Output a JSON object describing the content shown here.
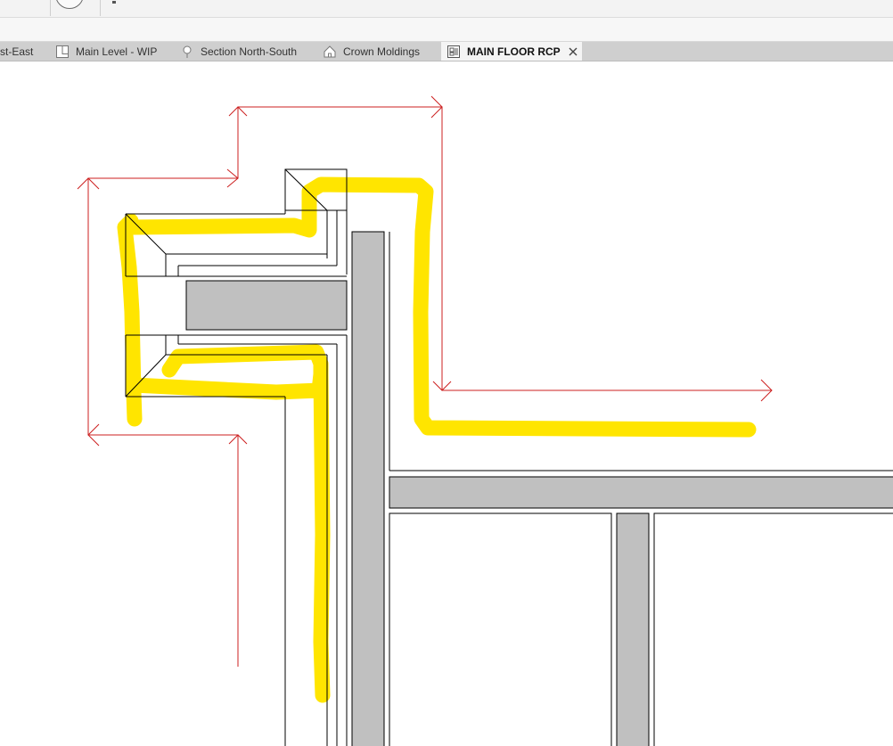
{
  "view_tabs": [
    {
      "label": "st-East",
      "icon": "none",
      "active": false
    },
    {
      "label": "Main Level - WIP",
      "icon": "sheet-icon",
      "active": false
    },
    {
      "label": "Section North-South",
      "icon": "section-view-icon",
      "active": false
    },
    {
      "label": "Crown Moldings",
      "icon": "home-view-icon",
      "active": false
    },
    {
      "label": "MAIN FLOOR RCP",
      "icon": "ceiling-plan-icon",
      "active": true
    }
  ],
  "colors": {
    "highlight": "#ffe500",
    "dimension_line": "#cc1f1f",
    "section_fill": "#c0c0c0",
    "linework": "#000000"
  }
}
